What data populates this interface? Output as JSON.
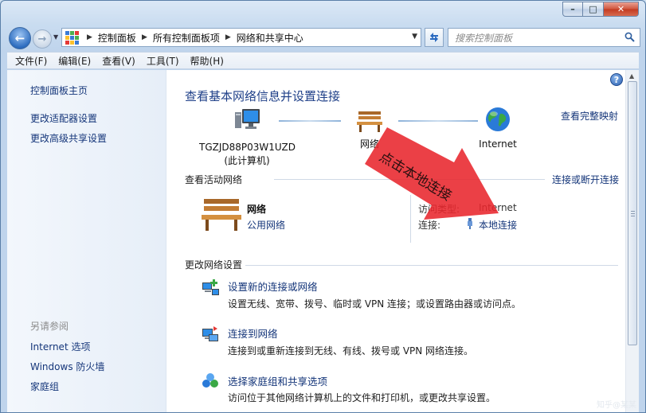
{
  "window": {
    "caption_min": "–",
    "caption_max": "□",
    "caption_close": "✕"
  },
  "nav": {
    "back": "←",
    "forward": "→",
    "breadcrumbs": [
      "控制面板",
      "所有控制面板项",
      "网络和共享中心"
    ],
    "search_placeholder": "搜索控制面板"
  },
  "menu": [
    "文件(F)",
    "编辑(E)",
    "查看(V)",
    "工具(T)",
    "帮助(H)"
  ],
  "sidebar": {
    "top_links": [
      "控制面板主页",
      "更改适配器设置",
      "更改高级共享设置"
    ],
    "see_also_heading": "另请参阅",
    "see_also_links": [
      "Internet 选项",
      "Windows 防火墙",
      "家庭组"
    ]
  },
  "main": {
    "title": "查看基本网络信息并设置连接",
    "full_map_link": "查看完整映射",
    "computer_name": "TGZJD88P03W1UZD",
    "computer_sub": "(此计算机)",
    "network_node": "网络",
    "internet_node": "Internet",
    "active_heading": "查看活动网络",
    "connect_disconnect": "连接或断开连接",
    "network_name": "网络",
    "network_type": "公用网络",
    "access_type_label": "访问类型:",
    "access_type_value": "Internet",
    "connection_label": "连接:",
    "connection_value": "本地连接",
    "change_heading": "更改网络设置",
    "tasks": [
      {
        "title": "设置新的连接或网络",
        "desc": "设置无线、宽带、拨号、临时或 VPN 连接；或设置路由器或访问点。"
      },
      {
        "title": "连接到网络",
        "desc": "连接到或重新连接到无线、有线、拨号或 VPN 网络连接。"
      },
      {
        "title": "选择家庭组和共享选项",
        "desc": "访问位于其他网络计算机上的文件和打印机，或更改共享设置。"
      }
    ]
  },
  "annotation": {
    "text": "点击本地连接",
    "color": "#e8262c"
  },
  "watermark": "知乎@某某"
}
